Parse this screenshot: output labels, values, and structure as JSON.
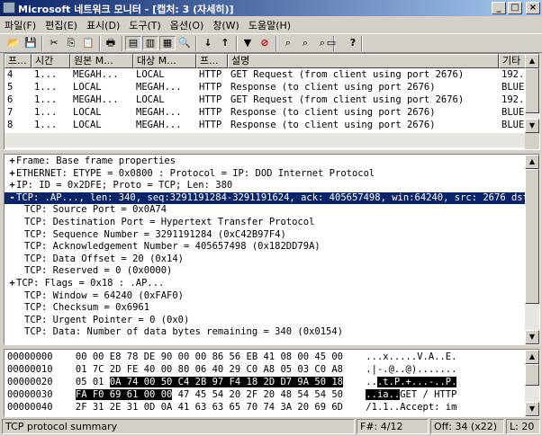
{
  "window": {
    "title": "Microsoft 네트워크 모니터 - [캡처: 3 (자세히)]"
  },
  "menubar": [
    "파일(F)",
    "편집(E)",
    "표시(D)",
    "도구(T)",
    "옵션(O)",
    "창(W)",
    "도움말(H)"
  ],
  "toolbar": {
    "icons": [
      "open-icon",
      "save-icon",
      "cut-icon",
      "copy-icon",
      "paste-icon",
      "print-icon",
      "pane-summary-icon",
      "pane-detail-icon",
      "pane-hex-icon",
      "zoom-icon",
      "arrow-down-icon",
      "arrow-up-icon",
      "filter-icon",
      "display-filter-icon",
      "find-icon",
      "find-next-icon",
      "find-prev-icon",
      "window-icon",
      "help-icon"
    ],
    "glyphs": [
      "📂",
      "💾",
      "✂",
      "⎘",
      "📋",
      "🖶",
      "▤",
      "▥",
      "▦",
      "🔍",
      "↓",
      "↑",
      "▼",
      "⊘",
      "⌕",
      "⌕",
      "⌕",
      "▭",
      "?"
    ]
  },
  "summary": {
    "columns": [
      "프...",
      "시간",
      "원본 M...",
      "대상 M...",
      "프...",
      "설명",
      "기타 ..."
    ],
    "rows": [
      [
        "4",
        "1...",
        "MEGAH...",
        "LOCAL",
        "HTTP",
        "GET Request (from client using port 2676)",
        "192."
      ],
      [
        "5",
        "1...",
        "LOCAL",
        "MEGAH...",
        "HTTP",
        "Response (to client using port 2676)",
        "BLUE"
      ],
      [
        "6",
        "1...",
        "MEGAH...",
        "LOCAL",
        "HTTP",
        "GET Request (from client using port 2676)",
        "192."
      ],
      [
        "7",
        "1...",
        "LOCAL",
        "MEGAH...",
        "HTTP",
        "Response (to client using port 2676)",
        "BLUE"
      ],
      [
        "8",
        "1...",
        "LOCAL",
        "MEGAH...",
        "HTTP",
        "Response (to client using port 2676)",
        "BLUE"
      ]
    ]
  },
  "detail": {
    "lines": [
      {
        "prefix": "+",
        "text": "Frame: Base frame properties"
      },
      {
        "prefix": "+",
        "text": "ETHERNET: ETYPE = 0x0800 : Protocol = IP:  DOD Internet Protocol"
      },
      {
        "prefix": "+",
        "text": "IP: ID = 0x2DFE; Proto = TCP; Len: 380"
      },
      {
        "prefix": "-",
        "text": "TCP: .AP..., len:  340, seq:3291191284-3291191624, ack: 405657498, win:64240, src: 2676  dst:"
      },
      {
        "prefix": "",
        "text": "TCP: Source Port = 0x0A74"
      },
      {
        "prefix": "",
        "text": "TCP: Destination Port = Hypertext Transfer Protocol"
      },
      {
        "prefix": "",
        "text": "TCP: Sequence Number = 3291191284 (0xC42B97F4)"
      },
      {
        "prefix": "",
        "text": "TCP: Acknowledgement Number = 405657498 (0x182DD79A)"
      },
      {
        "prefix": "",
        "text": "TCP: Data Offset = 20 (0x14)"
      },
      {
        "prefix": "",
        "text": "TCP: Reserved = 0 (0x0000)"
      },
      {
        "prefix": "+",
        "text": "TCP: Flags = 0x18 : .AP..."
      },
      {
        "prefix": "",
        "text": "TCP: Window = 64240 (0xFAF0)"
      },
      {
        "prefix": "",
        "text": "TCP: Checksum = 0x6961"
      },
      {
        "prefix": "",
        "text": "TCP: Urgent Pointer = 0 (0x0)"
      },
      {
        "prefix": "",
        "text": "TCP: Data: Number of data bytes remaining = 340 (0x0154)"
      }
    ],
    "selected_index": 3
  },
  "hex": {
    "lines": [
      {
        "offset": "00000000",
        "pre": "00 00 E8 78 DE 90 00 00 86 56 EB 41 08 00 45 00",
        "sel": "",
        "post": "",
        "apre": "...x.....V.A..E.",
        "asel": "",
        "apost": ""
      },
      {
        "offset": "00000010",
        "pre": "01 7C 2D FE 40 00 80 06 40 29 C0 A8 05 03 C0 A8",
        "sel": "",
        "post": "",
        "apre": ".|-.@..@).......",
        "asel": "",
        "apost": ""
      },
      {
        "offset": "00000020",
        "pre": "05 01 ",
        "sel": "0A 74 00 50 C4 2B 97 F4 18 2D D7 9A 50 18",
        "post": "",
        "apre": "..",
        "asel": ".t.P.+...-..P.",
        "apost": ""
      },
      {
        "offset": "00000030",
        "pre": "",
        "sel": "FA F0 69 61 00 00",
        "post": " 47 45 54 20 2F 20 48 54 54 50",
        "apre": "",
        "asel": "..ia..",
        "apost": "GET / HTTP"
      },
      {
        "offset": "00000040",
        "pre": "2F 31 2E 31 0D 0A 41 63 63 65 70 74 3A 20 69 6D",
        "sel": "",
        "post": "",
        "apre": "/1.1..Accept: im",
        "asel": "",
        "apost": ""
      }
    ]
  },
  "status": {
    "summary": "TCP protocol summary",
    "frame": "F#: 4/12",
    "offset": "Off: 34 (x22)",
    "length": "L: 20"
  }
}
